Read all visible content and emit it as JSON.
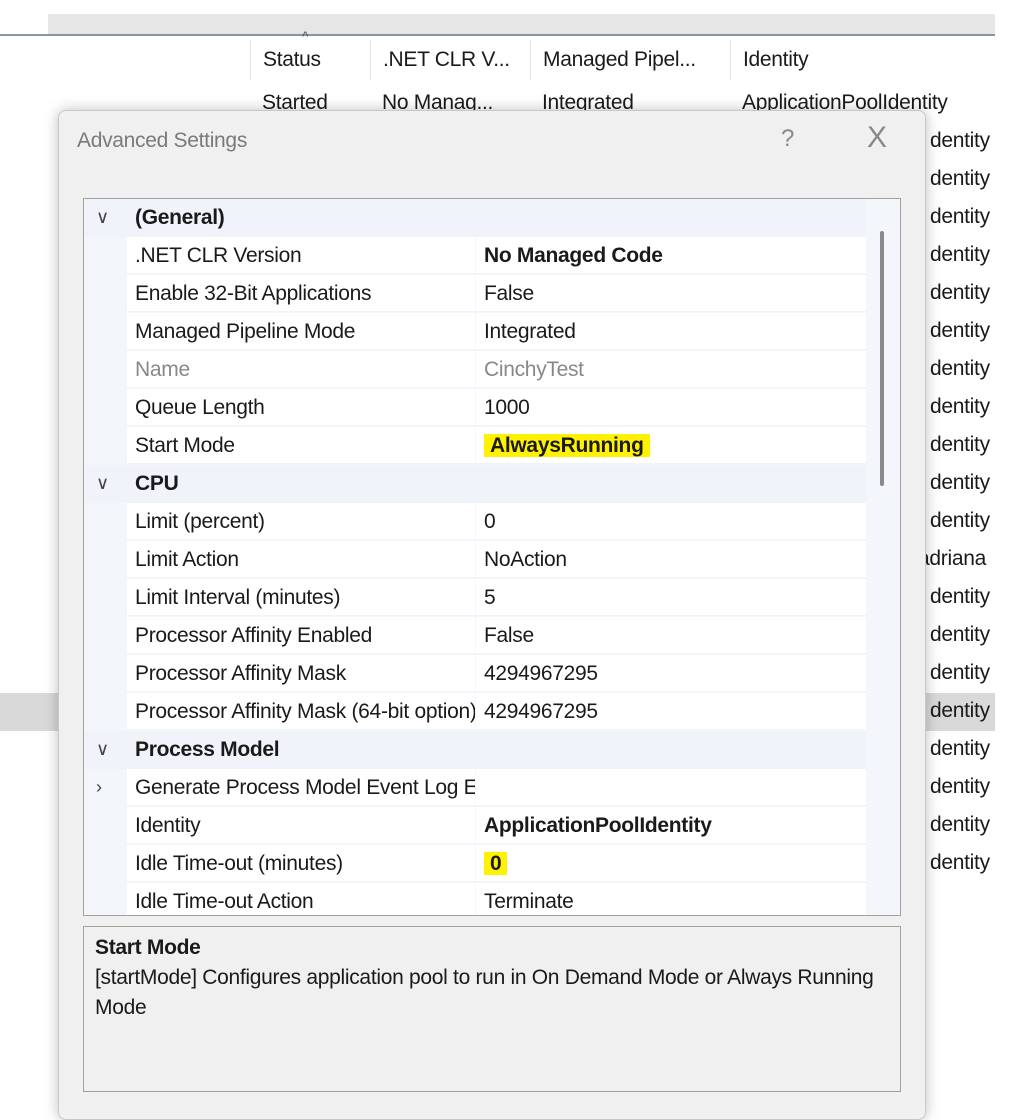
{
  "background_list": {
    "columns": [
      "Status",
      ".NET CLR V...",
      "Managed Pipel...",
      "Identity"
    ],
    "first_row": [
      "Started",
      "No Manag...",
      "Integrated",
      "ApplicationPoolIdentity"
    ],
    "identity_column": [
      "dentity",
      "dentity",
      "dentity",
      "dentity",
      "dentity",
      "dentity",
      "dentity",
      "dentity",
      "dentity",
      "dentity",
      "dentity",
      "adriana",
      "dentity",
      "dentity",
      "dentity",
      "dentity",
      "dentity",
      "dentity",
      "dentity",
      "dentity"
    ]
  },
  "dialog": {
    "title": "Advanced Settings",
    "help": "?",
    "close": "X",
    "rows": [
      {
        "type": "category",
        "label": "(General)"
      },
      {
        "type": "prop",
        "name": ".NET CLR Version",
        "value": "No Managed Code",
        "bold": true
      },
      {
        "type": "prop",
        "name": "Enable 32-Bit Applications",
        "value": "False"
      },
      {
        "type": "prop",
        "name": "Managed Pipeline Mode",
        "value": "Integrated"
      },
      {
        "type": "prop",
        "name": "Name",
        "value": "CinchyTest",
        "disabled": true
      },
      {
        "type": "prop",
        "name": "Queue Length",
        "value": "1000"
      },
      {
        "type": "prop",
        "name": "Start Mode",
        "value": "AlwaysRunning",
        "bold": true,
        "highlight": true
      },
      {
        "type": "category",
        "label": "CPU"
      },
      {
        "type": "prop",
        "name": "Limit (percent)",
        "value": "0"
      },
      {
        "type": "prop",
        "name": "Limit Action",
        "value": "NoAction"
      },
      {
        "type": "prop",
        "name": "Limit Interval (minutes)",
        "value": "5"
      },
      {
        "type": "prop",
        "name": "Processor Affinity Enabled",
        "value": "False"
      },
      {
        "type": "prop",
        "name": "Processor Affinity Mask",
        "value": "4294967295"
      },
      {
        "type": "prop",
        "name": "Processor Affinity Mask (64-bit option)",
        "value": "4294967295"
      },
      {
        "type": "category",
        "label": "Process Model"
      },
      {
        "type": "prop",
        "name": "Generate Process Model Event Log Entry",
        "value": "",
        "expandable": true
      },
      {
        "type": "prop",
        "name": "Identity",
        "value": "ApplicationPoolIdentity",
        "bold": true
      },
      {
        "type": "prop",
        "name": "Idle Time-out (minutes)",
        "value": "0",
        "bold": true,
        "highlight": true
      },
      {
        "type": "prop",
        "name": "Idle Time-out Action",
        "value": "Terminate"
      }
    ],
    "description": {
      "title": "Start Mode",
      "text": "[startMode] Configures application pool to run in On Demand Mode or Always Running Mode"
    }
  },
  "colors": {
    "highlight": "#fff200",
    "category_bg": "#f0f3fa"
  }
}
